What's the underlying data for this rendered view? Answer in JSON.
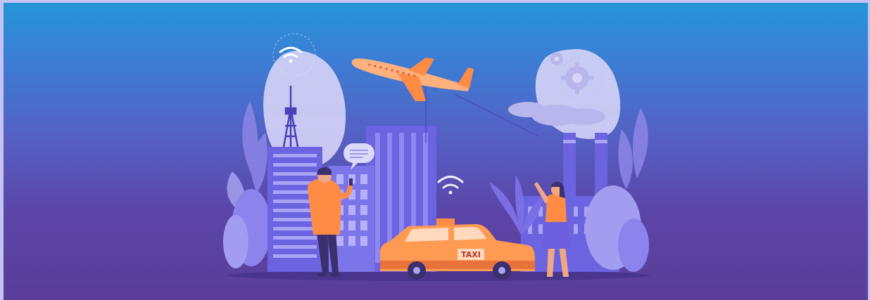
{
  "banner": {
    "taxi_sign": "TAXI",
    "colors": {
      "sky_top": "#2596d8",
      "sky_bottom": "#5a3e98",
      "accent_orange": "#ff8b45",
      "building_purple": "#6b63e0",
      "cloud_lavender": "#d6d4f7"
    },
    "icons": [
      "wifi-icon",
      "gear-icon",
      "chat-bubble-icon",
      "airplane-icon",
      "taxi-icon",
      "cell-tower-icon"
    ]
  }
}
